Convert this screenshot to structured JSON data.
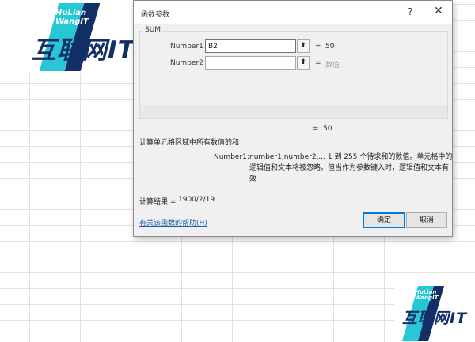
{
  "dialog": {
    "title": "函数参数",
    "help_glyph": "?",
    "close_glyph": "✕",
    "function_name": "SUM",
    "arguments": [
      {
        "label": "Number1",
        "value": "B2",
        "placeholder": "",
        "result": "50",
        "result_muted": false
      },
      {
        "label": "Number2",
        "value": "",
        "placeholder": "",
        "result": "数值",
        "result_muted": true
      }
    ],
    "equals": "=",
    "ref_glyph": "⬆",
    "formula_result": "50",
    "function_description": "计算单元格区域中所有数值的和",
    "arg_desc_name": "Number1:",
    "arg_desc_text": "number1,number2,... 1 到 255 个待求和的数值。单元格中的逻辑值和文本将被忽略。但当作为参数键入时，逻辑值和文本有效",
    "calc_result_label": "计算结果 =",
    "calc_result_value": "1900/2/19",
    "help_link": "有关该函数的帮助(H)",
    "ok_label": "确定",
    "cancel_label": "取消"
  },
  "logos": {
    "top": {
      "sub_line1": "HuLian",
      "sub_line2": "WangIT",
      "main": "互联网IT"
    },
    "bottom": {
      "sub_line1": "HuLian",
      "sub_line2": "WangIT",
      "main": "互联网IT"
    }
  },
  "colors": {
    "accent_blue": "#0078d7",
    "logo_teal": "#27c7d8",
    "logo_navy": "#142f66",
    "link": "#1a5aa8"
  }
}
